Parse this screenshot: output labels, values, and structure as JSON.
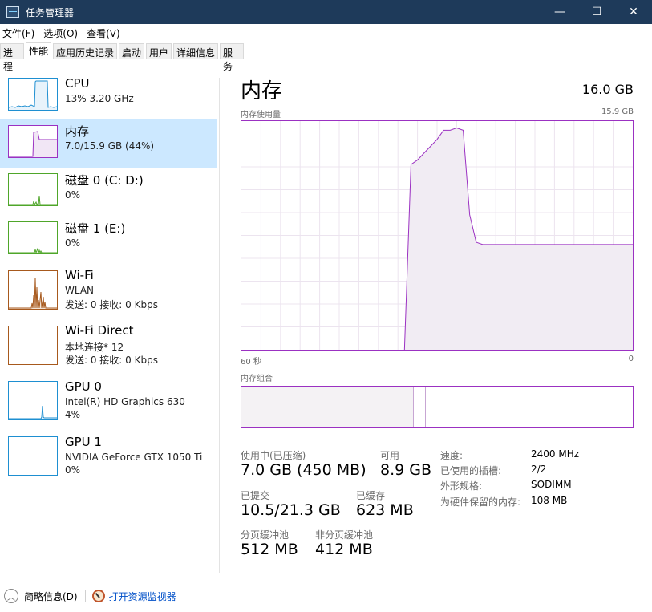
{
  "window": {
    "title": "任务管理器",
    "minimize_glyph": "—",
    "maximize_glyph": "☐",
    "close_glyph": "✕"
  },
  "menu": [
    "文件(F)",
    "选项(O)",
    "查看(V)"
  ],
  "tabs": [
    {
      "label": "进程",
      "active": false
    },
    {
      "label": "性能",
      "active": true
    },
    {
      "label": "应用历史记录",
      "active": false
    },
    {
      "label": "启动",
      "active": false
    },
    {
      "label": "用户",
      "active": false
    },
    {
      "label": "详细信息",
      "active": false
    },
    {
      "label": "服务",
      "active": false
    }
  ],
  "sidebar": {
    "items": [
      {
        "title": "CPU",
        "line1": "13%  3.20 GHz",
        "line2": "",
        "color": "#1e8fd1",
        "active": false
      },
      {
        "title": "内存",
        "line1": "7.0/15.9 GB (44%)",
        "line2": "",
        "color": "#9b31c2",
        "active": true
      },
      {
        "title": "磁盘 0 (C: D:)",
        "line1": "0%",
        "line2": "",
        "color": "#4fa62a",
        "active": false
      },
      {
        "title": "磁盘 1 (E:)",
        "line1": "0%",
        "line2": "",
        "color": "#4fa62a",
        "active": false
      },
      {
        "title": "Wi-Fi",
        "line1": "WLAN",
        "line2": "发送: 0 接收: 0 Kbps",
        "color": "#a7591d",
        "active": false
      },
      {
        "title": "Wi-Fi Direct",
        "line1": "本地连接* 12",
        "line2": "发送: 0 接收: 0 Kbps",
        "color": "#a7591d",
        "active": false
      },
      {
        "title": "GPU 0",
        "line1": "Intel(R) HD Graphics 630",
        "line2": "4%",
        "color": "#1e8fd1",
        "active": false
      },
      {
        "title": "GPU 1",
        "line1": "NVIDIA GeForce GTX 1050 Ti",
        "line2": "0%",
        "color": "#1e8fd1",
        "active": false
      }
    ]
  },
  "memory": {
    "title": "内存",
    "total": "16.0 GB",
    "usage_label": "内存使用量",
    "usage_max": "15.9 GB",
    "axis_left": "60 秒",
    "axis_right": "0",
    "composition_label": "内存组合",
    "composition": {
      "in_use_fraction": 0.441,
      "modified_fraction": 0.03
    },
    "usage_history_percent": [
      0,
      0,
      0,
      0,
      0,
      0,
      0,
      0,
      0,
      0,
      0,
      0,
      0,
      0,
      0,
      0,
      0,
      0,
      0,
      0,
      0,
      0,
      0,
      0,
      0,
      0,
      81,
      83,
      86,
      89,
      92,
      96,
      96,
      97,
      96,
      59,
      47,
      46,
      46,
      46,
      46,
      46,
      46,
      46,
      46,
      46,
      46,
      46,
      46,
      46,
      46,
      46,
      46,
      46,
      46,
      46,
      46,
      46,
      46,
      46,
      46
    ],
    "stats": {
      "in_use_label": "使用中(已压缩)",
      "in_use_value": "7.0 GB (450 MB)",
      "available_label": "可用",
      "available_value": "8.9 GB",
      "committed_label": "已提交",
      "committed_value": "10.5/21.3 GB",
      "cached_label": "已缓存",
      "cached_value": "623 MB",
      "paged_label": "分页缓冲池",
      "paged_value": "512 MB",
      "nonpaged_label": "非分页缓冲池",
      "nonpaged_value": "412 MB"
    },
    "props": [
      {
        "label": "速度:",
        "value": "2400 MHz"
      },
      {
        "label": "已使用的插槽:",
        "value": "2/2"
      },
      {
        "label": "外形规格:",
        "value": "SODIMM"
      },
      {
        "label": "为硬件保留的内存:",
        "value": "108 MB"
      }
    ]
  },
  "footer": {
    "fewer_details": "简略信息(D)",
    "open_monitor": "打开资源监视器"
  }
}
